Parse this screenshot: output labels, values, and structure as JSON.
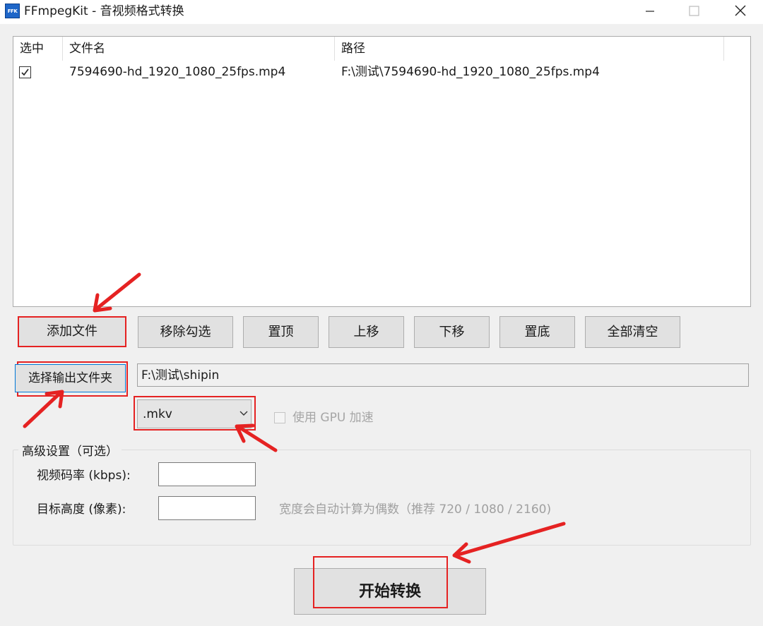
{
  "window": {
    "app_icon_text": "FFK",
    "title": "FFmpegKit - 音视频格式转换",
    "minimize_glyph": "—",
    "maximize_glyph": "☐",
    "close_glyph": "✕"
  },
  "file_list": {
    "columns": [
      "选中",
      "文件名",
      "路径"
    ],
    "rows": [
      {
        "checked": true,
        "check_glyph": "✓",
        "name": "7594690-hd_1920_1080_25fps.mp4",
        "path": "F:\\测试\\7594690-hd_1920_1080_25fps.mp4"
      }
    ]
  },
  "toolbar": {
    "add_file": "添加文件",
    "remove_checked": "移除勾选",
    "move_top": "置顶",
    "move_up": "上移",
    "move_down": "下移",
    "move_bottom": "置底",
    "clear_all": "全部清空"
  },
  "output": {
    "choose_folder": "选择输出文件夹",
    "folder_path": "F:\\测试\\shipin"
  },
  "format": {
    "selected": ".mkv",
    "chevron_glyph": "⌄"
  },
  "gpu": {
    "label": "使用 GPU 加速",
    "checked": false,
    "enabled": false
  },
  "advanced": {
    "title": "高级设置（可选）",
    "bitrate_label": "视频码率 (kbps):",
    "bitrate_value": "",
    "height_label": "目标高度 (像素):",
    "height_value": "",
    "hint": "宽度会自动计算为偶数（推荐 720 / 1080 / 2160)"
  },
  "actions": {
    "start": "开始转换"
  },
  "colors": {
    "annotation_red": "#e52222",
    "focus_blue": "#0078d7"
  }
}
